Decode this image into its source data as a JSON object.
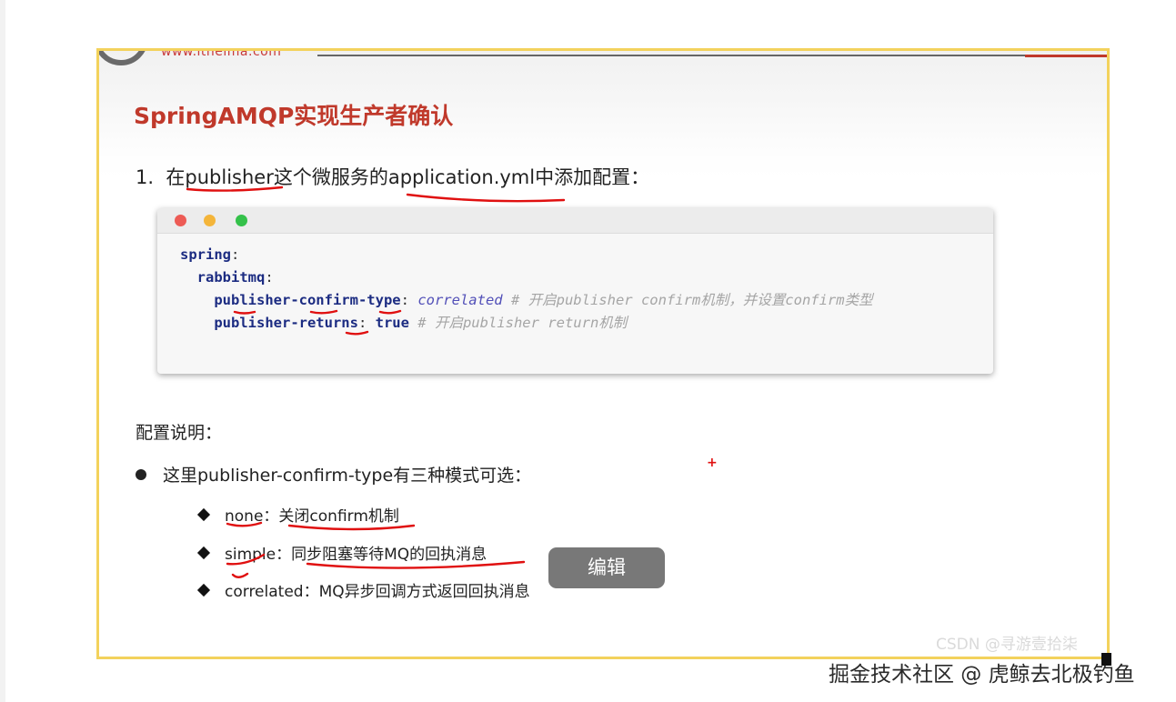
{
  "header": {
    "site_url": "www.itheima.com"
  },
  "slide": {
    "title": "SpringAMQP实现生产者确认",
    "step1": {
      "number": "1.",
      "prefix": "在",
      "service": "publisher",
      "middle": "这个微服务的",
      "file": "application.yml",
      "suffix": "中添加配置："
    },
    "code": {
      "line1": {
        "key": "spring",
        "colon": ":"
      },
      "line2": {
        "key": "rabbitmq",
        "colon": ":"
      },
      "line3": {
        "key": "publisher-confirm-type",
        "colon": ": ",
        "value": "correlated",
        "comment": " # 开启publisher confirm机制，并设置confirm类型"
      },
      "line4": {
        "key": "publisher-returns",
        "colon": ": ",
        "value": "true",
        "comment": " # 开启publisher return机制"
      }
    },
    "notes_heading": "配置说明：",
    "bullet": "这里publisher-confirm-type有三种模式可选：",
    "modes": [
      {
        "name": "none",
        "sep": "：",
        "desc": "关闭confirm机制"
      },
      {
        "name": "simple",
        "sep": "：",
        "desc": "同步阻塞等待MQ的回执消息"
      },
      {
        "name": "correlated",
        "sep": "：",
        "desc": "MQ异步回调方式返回回执消息"
      }
    ]
  },
  "overlay": {
    "edit_button": "编辑",
    "cursor_mark": "+"
  },
  "watermarks": {
    "csdn": "CSDN @寻游壹拾柒",
    "juejin": "掘金技术社区 @ 虎鲸去北极钓鱼"
  },
  "colors": {
    "title_red": "#c0392b",
    "slide_border": "#f3d25c",
    "annotation_red": "#e01010",
    "code_key": "#1c2c82",
    "code_value": "#5250b8"
  }
}
